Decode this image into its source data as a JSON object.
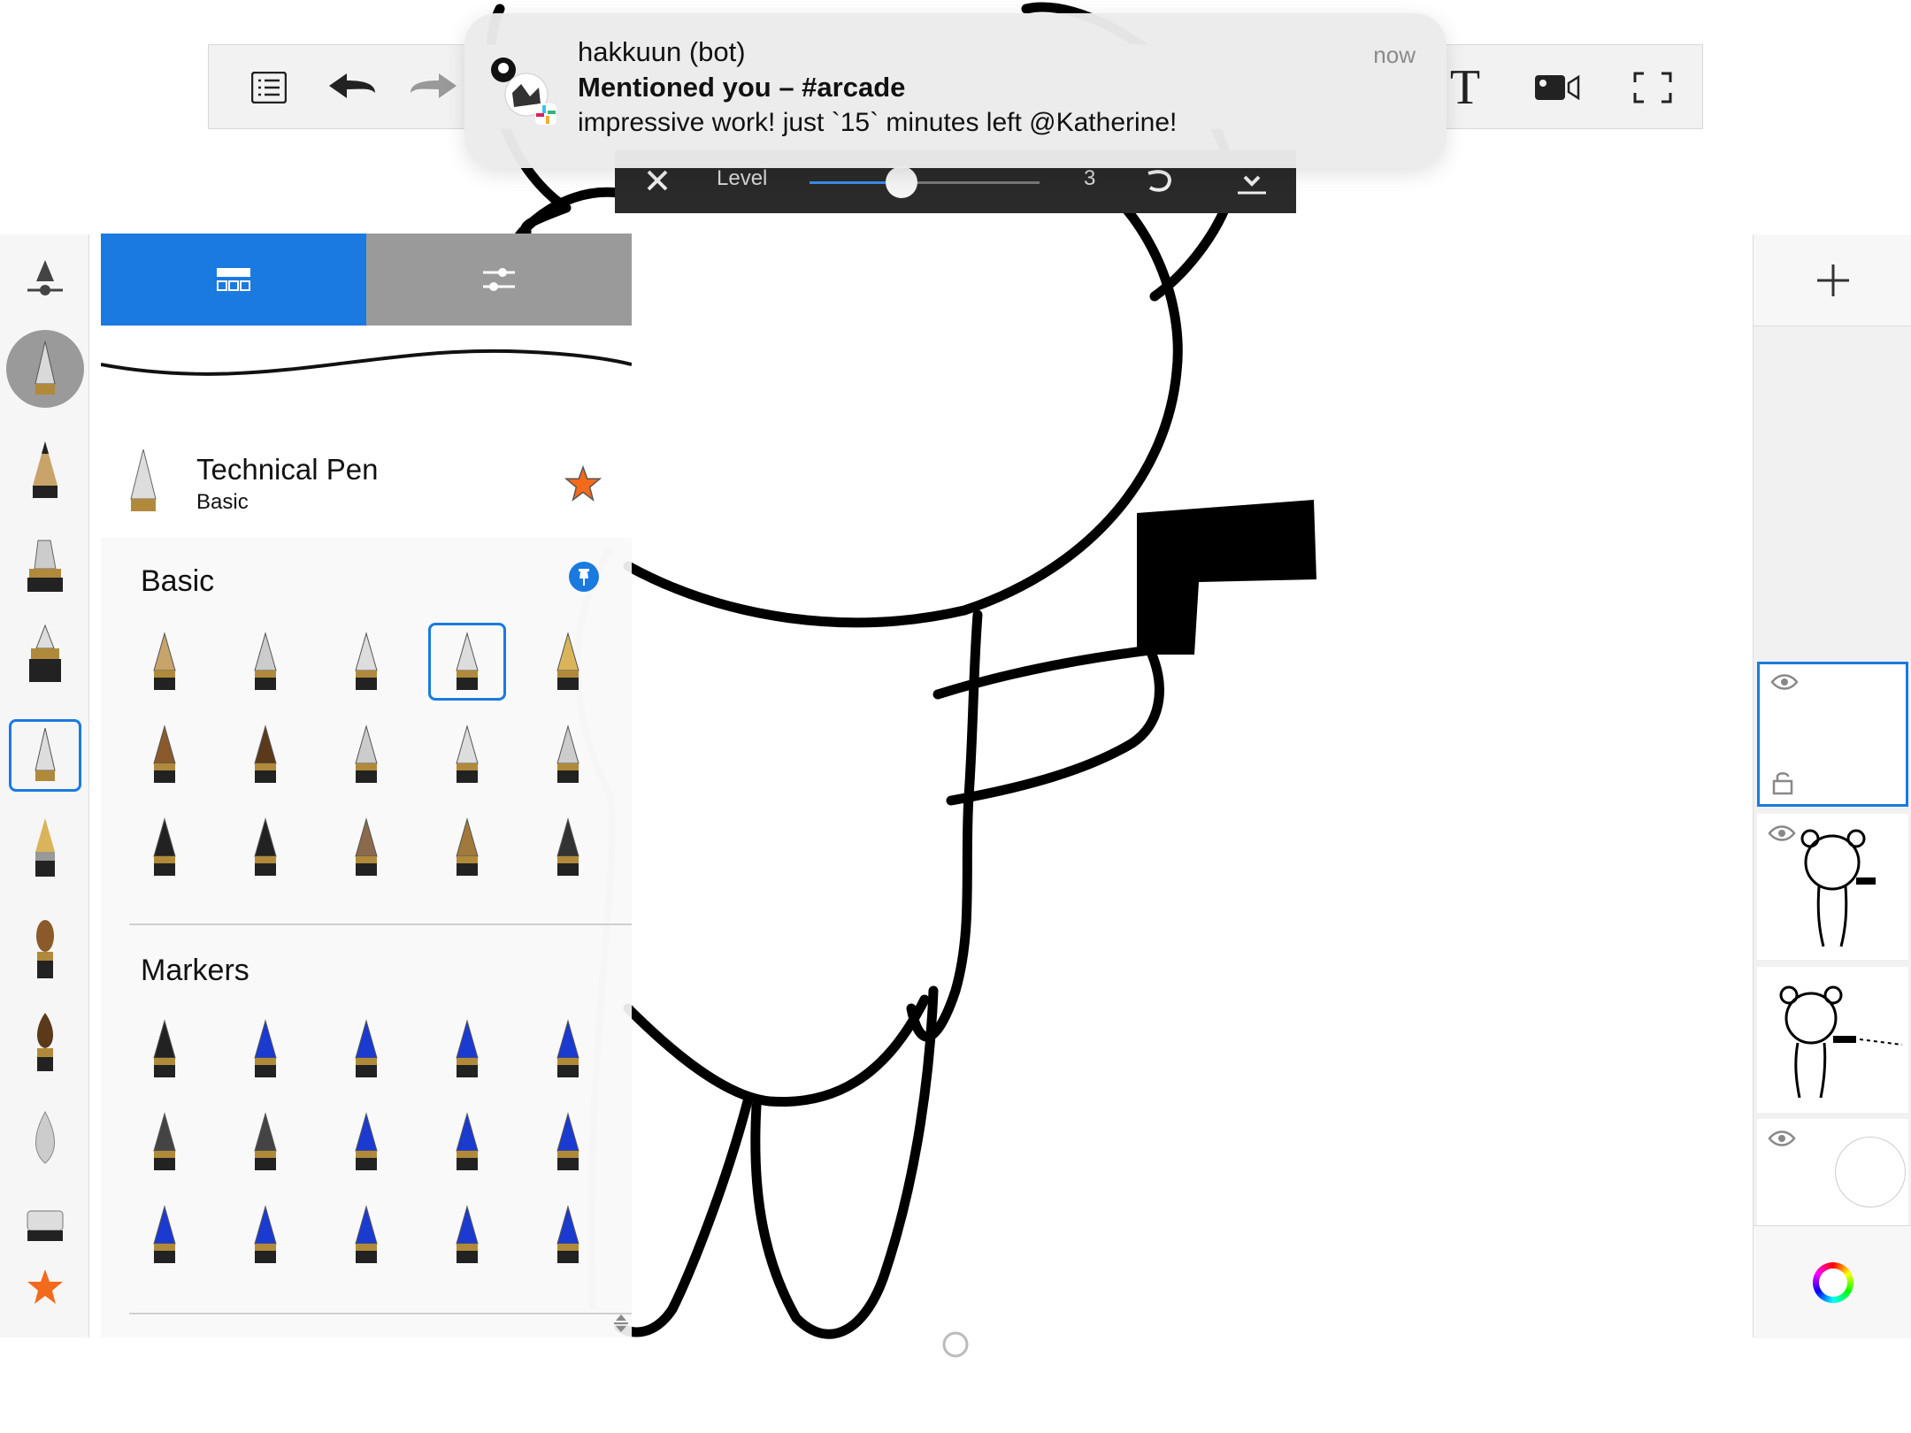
{
  "notification": {
    "sender": "hakkuun (bot)",
    "title": "Mentioned you – #arcade",
    "body": "impressive work! just `15` minutes left @Katherine!",
    "time": "now"
  },
  "level_bar": {
    "label": "Level",
    "value": "3",
    "slider_fraction": 0.4
  },
  "toolbar": {
    "icons": [
      "list-icon",
      "undo-icon",
      "redo-icon",
      "text-icon",
      "video-icon",
      "fullscreen-icon"
    ],
    "text_tool_glyph": "T"
  },
  "brush_panel": {
    "tabs": [
      "library-tab",
      "settings-tab"
    ],
    "active_tab": "library-tab",
    "selected_brush": {
      "name": "Technical Pen",
      "set": "Basic"
    },
    "sections": [
      {
        "title": "Basic",
        "rows": 3,
        "cols": 5
      },
      {
        "title": "Markers",
        "rows": 3,
        "cols": 5
      }
    ]
  },
  "layers": {
    "count": 4,
    "selected_index": 0
  },
  "colors": {
    "accent": "#1a7ae0",
    "star": "#f26a1b",
    "toolbar_bg": "#f2f2f2",
    "level_bar_bg": "#2a2a2a"
  }
}
